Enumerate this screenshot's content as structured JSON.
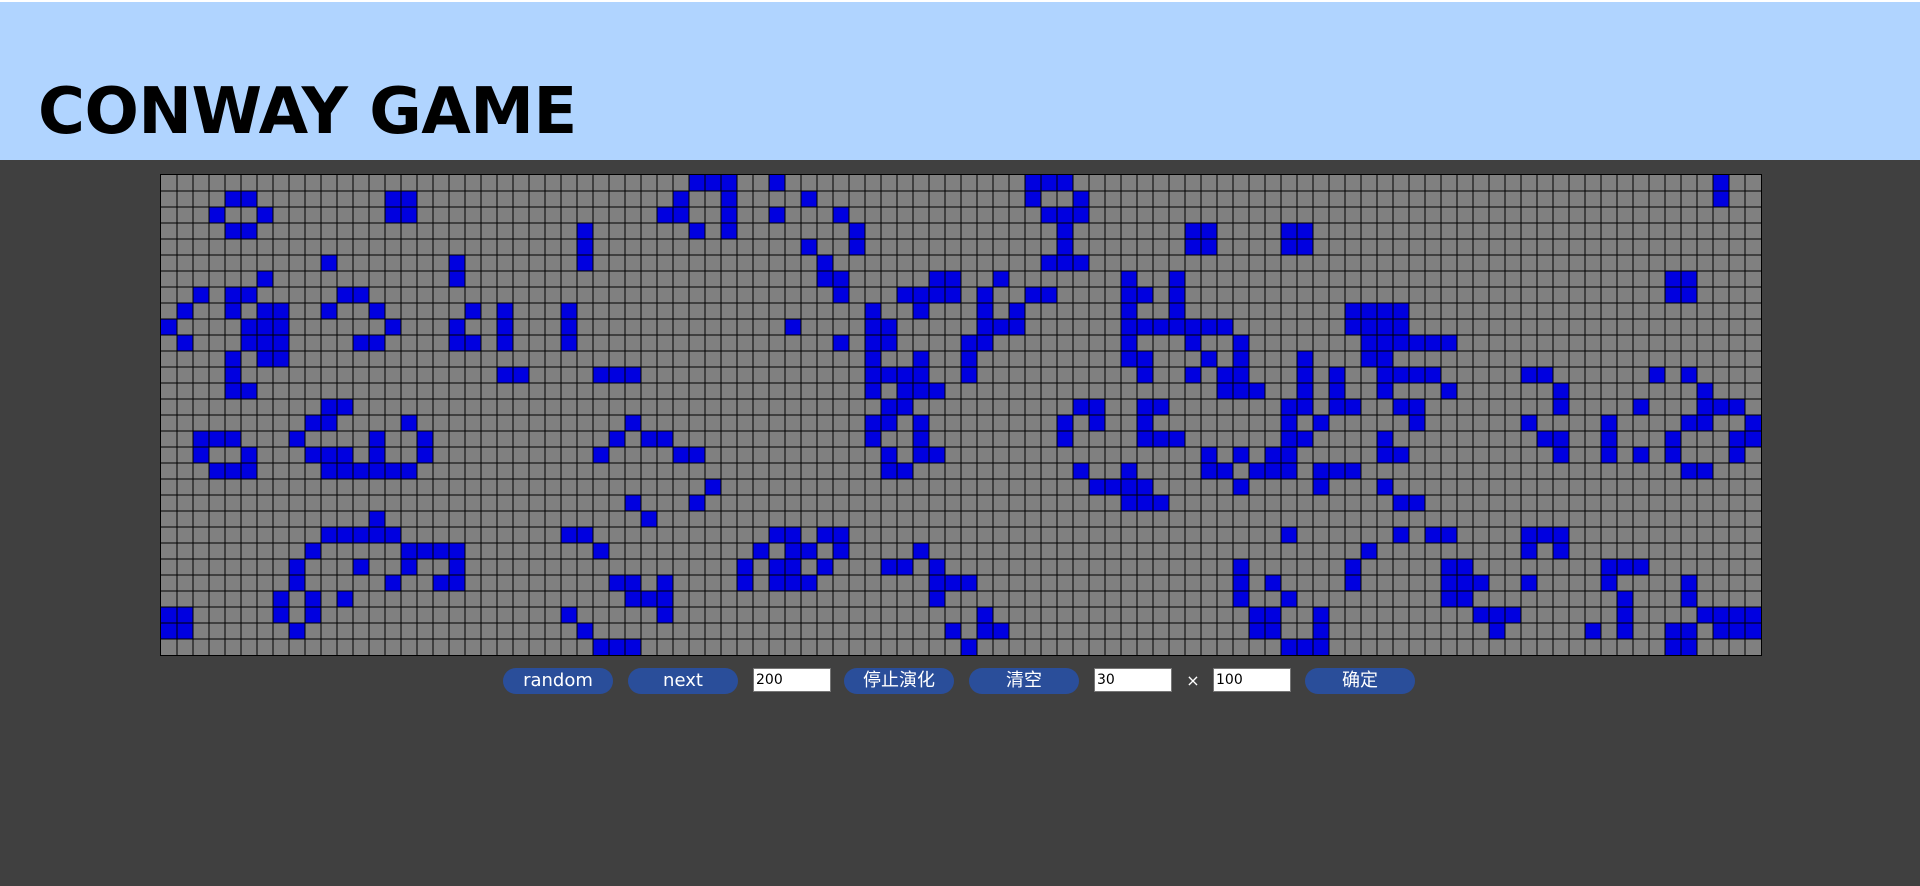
{
  "header": {
    "title": "CONWAY GAME",
    "background_color": "#b0d4ff"
  },
  "board": {
    "rows": 30,
    "cols": 100,
    "cell_color": "#808080",
    "live_color": "#0000e0",
    "grid_color": "#000000",
    "live_cells": [
      [
        0,
        33
      ],
      [
        0,
        34
      ],
      [
        0,
        35
      ],
      [
        0,
        38
      ],
      [
        0,
        54
      ],
      [
        0,
        55
      ],
      [
        0,
        56
      ],
      [
        0,
        97
      ],
      [
        1,
        4
      ],
      [
        1,
        5
      ],
      [
        1,
        14
      ],
      [
        1,
        15
      ],
      [
        1,
        32
      ],
      [
        1,
        35
      ],
      [
        1,
        40
      ],
      [
        1,
        54
      ],
      [
        1,
        57
      ],
      [
        1,
        97
      ],
      [
        2,
        3
      ],
      [
        2,
        6
      ],
      [
        2,
        14
      ],
      [
        2,
        15
      ],
      [
        2,
        31
      ],
      [
        2,
        32
      ],
      [
        2,
        35
      ],
      [
        2,
        38
      ],
      [
        2,
        42
      ],
      [
        2,
        55
      ],
      [
        2,
        56
      ],
      [
        2,
        57
      ],
      [
        3,
        4
      ],
      [
        3,
        5
      ],
      [
        3,
        26
      ],
      [
        3,
        33
      ],
      [
        3,
        35
      ],
      [
        3,
        43
      ],
      [
        3,
        56
      ],
      [
        3,
        64
      ],
      [
        3,
        65
      ],
      [
        3,
        70
      ],
      [
        3,
        71
      ],
      [
        4,
        26
      ],
      [
        4,
        40
      ],
      [
        4,
        43
      ],
      [
        4,
        56
      ],
      [
        4,
        64
      ],
      [
        4,
        65
      ],
      [
        4,
        70
      ],
      [
        4,
        71
      ],
      [
        5,
        10
      ],
      [
        5,
        18
      ],
      [
        5,
        26
      ],
      [
        5,
        41
      ],
      [
        5,
        55
      ],
      [
        5,
        56
      ],
      [
        5,
        57
      ],
      [
        6,
        6
      ],
      [
        6,
        18
      ],
      [
        6,
        41
      ],
      [
        6,
        42
      ],
      [
        6,
        48
      ],
      [
        6,
        49
      ],
      [
        6,
        52
      ],
      [
        6,
        60
      ],
      [
        6,
        63
      ],
      [
        6,
        94
      ],
      [
        6,
        95
      ],
      [
        7,
        2
      ],
      [
        7,
        4
      ],
      [
        7,
        5
      ],
      [
        7,
        11
      ],
      [
        7,
        12
      ],
      [
        7,
        42
      ],
      [
        7,
        46
      ],
      [
        7,
        47
      ],
      [
        7,
        48
      ],
      [
        7,
        49
      ],
      [
        7,
        51
      ],
      [
        7,
        54
      ],
      [
        7,
        55
      ],
      [
        7,
        60
      ],
      [
        7,
        61
      ],
      [
        7,
        63
      ],
      [
        7,
        94
      ],
      [
        7,
        95
      ],
      [
        8,
        1
      ],
      [
        8,
        4
      ],
      [
        8,
        6
      ],
      [
        8,
        7
      ],
      [
        8,
        10
      ],
      [
        8,
        13
      ],
      [
        8,
        19
      ],
      [
        8,
        21
      ],
      [
        8,
        25
      ],
      [
        8,
        44
      ],
      [
        8,
        47
      ],
      [
        8,
        51
      ],
      [
        8,
        53
      ],
      [
        8,
        60
      ],
      [
        8,
        63
      ],
      [
        8,
        74
      ],
      [
        8,
        75
      ],
      [
        8,
        76
      ],
      [
        8,
        77
      ],
      [
        9,
        0
      ],
      [
        9,
        5
      ],
      [
        9,
        6
      ],
      [
        9,
        7
      ],
      [
        9,
        14
      ],
      [
        9,
        18
      ],
      [
        9,
        21
      ],
      [
        9,
        25
      ],
      [
        9,
        39
      ],
      [
        9,
        44
      ],
      [
        9,
        45
      ],
      [
        9,
        51
      ],
      [
        9,
        52
      ],
      [
        9,
        53
      ],
      [
        9,
        60
      ],
      [
        9,
        61
      ],
      [
        9,
        62
      ],
      [
        9,
        63
      ],
      [
        9,
        64
      ],
      [
        9,
        65
      ],
      [
        9,
        66
      ],
      [
        9,
        74
      ],
      [
        9,
        75
      ],
      [
        9,
        76
      ],
      [
        9,
        77
      ],
      [
        10,
        1
      ],
      [
        10,
        5
      ],
      [
        10,
        6
      ],
      [
        10,
        7
      ],
      [
        10,
        12
      ],
      [
        10,
        13
      ],
      [
        10,
        18
      ],
      [
        10,
        19
      ],
      [
        10,
        21
      ],
      [
        10,
        25
      ],
      [
        10,
        42
      ],
      [
        10,
        44
      ],
      [
        10,
        45
      ],
      [
        10,
        50
      ],
      [
        10,
        51
      ],
      [
        10,
        60
      ],
      [
        10,
        64
      ],
      [
        10,
        67
      ],
      [
        10,
        75
      ],
      [
        10,
        76
      ],
      [
        10,
        77
      ],
      [
        10,
        78
      ],
      [
        10,
        79
      ],
      [
        10,
        80
      ],
      [
        11,
        4
      ],
      [
        11,
        6
      ],
      [
        11,
        7
      ],
      [
        11,
        44
      ],
      [
        11,
        47
      ],
      [
        11,
        50
      ],
      [
        11,
        60
      ],
      [
        11,
        61
      ],
      [
        11,
        65
      ],
      [
        11,
        67
      ],
      [
        11,
        71
      ],
      [
        11,
        75
      ],
      [
        11,
        76
      ],
      [
        12,
        4
      ],
      [
        12,
        21
      ],
      [
        12,
        22
      ],
      [
        12,
        27
      ],
      [
        12,
        28
      ],
      [
        12,
        29
      ],
      [
        12,
        44
      ],
      [
        12,
        45
      ],
      [
        12,
        46
      ],
      [
        12,
        47
      ],
      [
        12,
        50
      ],
      [
        12,
        61
      ],
      [
        12,
        64
      ],
      [
        12,
        66
      ],
      [
        12,
        67
      ],
      [
        12,
        71
      ],
      [
        12,
        73
      ],
      [
        12,
        76
      ],
      [
        12,
        77
      ],
      [
        12,
        78
      ],
      [
        12,
        79
      ],
      [
        12,
        85
      ],
      [
        12,
        86
      ],
      [
        12,
        93
      ],
      [
        12,
        95
      ],
      [
        13,
        4
      ],
      [
        13,
        5
      ],
      [
        13,
        44
      ],
      [
        13,
        46
      ],
      [
        13,
        47
      ],
      [
        13,
        48
      ],
      [
        13,
        66
      ],
      [
        13,
        67
      ],
      [
        13,
        68
      ],
      [
        13,
        71
      ],
      [
        13,
        73
      ],
      [
        13,
        76
      ],
      [
        13,
        80
      ],
      [
        13,
        87
      ],
      [
        13,
        96
      ],
      [
        14,
        10
      ],
      [
        14,
        11
      ],
      [
        14,
        45
      ],
      [
        14,
        46
      ],
      [
        14,
        57
      ],
      [
        14,
        58
      ],
      [
        14,
        61
      ],
      [
        14,
        62
      ],
      [
        14,
        70
      ],
      [
        14,
        71
      ],
      [
        14,
        73
      ],
      [
        14,
        74
      ],
      [
        14,
        77
      ],
      [
        14,
        78
      ],
      [
        14,
        87
      ],
      [
        14,
        92
      ],
      [
        14,
        96
      ],
      [
        14,
        97
      ],
      [
        14,
        98
      ],
      [
        15,
        9
      ],
      [
        15,
        10
      ],
      [
        15,
        15
      ],
      [
        15,
        29
      ],
      [
        15,
        44
      ],
      [
        15,
        45
      ],
      [
        15,
        47
      ],
      [
        15,
        56
      ],
      [
        15,
        58
      ],
      [
        15,
        61
      ],
      [
        15,
        70
      ],
      [
        15,
        72
      ],
      [
        15,
        78
      ],
      [
        15,
        85
      ],
      [
        15,
        90
      ],
      [
        15,
        95
      ],
      [
        15,
        96
      ],
      [
        15,
        99
      ],
      [
        16,
        2
      ],
      [
        16,
        3
      ],
      [
        16,
        4
      ],
      [
        16,
        8
      ],
      [
        16,
        13
      ],
      [
        16,
        16
      ],
      [
        16,
        28
      ],
      [
        16,
        30
      ],
      [
        16,
        31
      ],
      [
        16,
        44
      ],
      [
        16,
        47
      ],
      [
        16,
        56
      ],
      [
        16,
        61
      ],
      [
        16,
        62
      ],
      [
        16,
        63
      ],
      [
        16,
        70
      ],
      [
        16,
        71
      ],
      [
        16,
        76
      ],
      [
        16,
        86
      ],
      [
        16,
        87
      ],
      [
        16,
        90
      ],
      [
        16,
        94
      ],
      [
        16,
        98
      ],
      [
        16,
        99
      ],
      [
        17,
        2
      ],
      [
        17,
        5
      ],
      [
        17,
        9
      ],
      [
        17,
        10
      ],
      [
        17,
        11
      ],
      [
        17,
        13
      ],
      [
        17,
        16
      ],
      [
        17,
        27
      ],
      [
        17,
        32
      ],
      [
        17,
        33
      ],
      [
        17,
        45
      ],
      [
        17,
        47
      ],
      [
        17,
        48
      ],
      [
        17,
        65
      ],
      [
        17,
        67
      ],
      [
        17,
        69
      ],
      [
        17,
        70
      ],
      [
        17,
        76
      ],
      [
        17,
        77
      ],
      [
        17,
        87
      ],
      [
        17,
        90
      ],
      [
        17,
        92
      ],
      [
        17,
        94
      ],
      [
        17,
        98
      ],
      [
        18,
        3
      ],
      [
        18,
        4
      ],
      [
        18,
        5
      ],
      [
        18,
        10
      ],
      [
        18,
        11
      ],
      [
        18,
        12
      ],
      [
        18,
        13
      ],
      [
        18,
        14
      ],
      [
        18,
        15
      ],
      [
        18,
        45
      ],
      [
        18,
        46
      ],
      [
        18,
        57
      ],
      [
        18,
        60
      ],
      [
        18,
        65
      ],
      [
        18,
        66
      ],
      [
        18,
        68
      ],
      [
        18,
        69
      ],
      [
        18,
        70
      ],
      [
        18,
        72
      ],
      [
        18,
        73
      ],
      [
        18,
        74
      ],
      [
        18,
        95
      ],
      [
        18,
        96
      ],
      [
        19,
        34
      ],
      [
        19,
        58
      ],
      [
        19,
        59
      ],
      [
        19,
        60
      ],
      [
        19,
        61
      ],
      [
        19,
        67
      ],
      [
        19,
        72
      ],
      [
        19,
        76
      ],
      [
        20,
        29
      ],
      [
        20,
        33
      ],
      [
        20,
        60
      ],
      [
        20,
        61
      ],
      [
        20,
        62
      ],
      [
        20,
        77
      ],
      [
        20,
        78
      ],
      [
        21,
        13
      ],
      [
        21,
        30
      ],
      [
        22,
        10
      ],
      [
        22,
        11
      ],
      [
        22,
        12
      ],
      [
        22,
        13
      ],
      [
        22,
        14
      ],
      [
        22,
        25
      ],
      [
        22,
        26
      ],
      [
        22,
        38
      ],
      [
        22,
        39
      ],
      [
        22,
        41
      ],
      [
        22,
        42
      ],
      [
        22,
        70
      ],
      [
        22,
        77
      ],
      [
        22,
        79
      ],
      [
        22,
        80
      ],
      [
        22,
        85
      ],
      [
        22,
        86
      ],
      [
        22,
        87
      ],
      [
        23,
        9
      ],
      [
        23,
        15
      ],
      [
        23,
        16
      ],
      [
        23,
        17
      ],
      [
        23,
        18
      ],
      [
        23,
        27
      ],
      [
        23,
        37
      ],
      [
        23,
        39
      ],
      [
        23,
        40
      ],
      [
        23,
        42
      ],
      [
        23,
        47
      ],
      [
        23,
        75
      ],
      [
        23,
        85
      ],
      [
        23,
        87
      ],
      [
        24,
        8
      ],
      [
        24,
        12
      ],
      [
        24,
        15
      ],
      [
        24,
        18
      ],
      [
        24,
        36
      ],
      [
        24,
        38
      ],
      [
        24,
        39
      ],
      [
        24,
        41
      ],
      [
        24,
        45
      ],
      [
        24,
        46
      ],
      [
        24,
        48
      ],
      [
        24,
        67
      ],
      [
        24,
        74
      ],
      [
        24,
        80
      ],
      [
        24,
        81
      ],
      [
        24,
        90
      ],
      [
        24,
        91
      ],
      [
        24,
        92
      ],
      [
        25,
        8
      ],
      [
        25,
        14
      ],
      [
        25,
        17
      ],
      [
        25,
        18
      ],
      [
        25,
        28
      ],
      [
        25,
        29
      ],
      [
        25,
        31
      ],
      [
        25,
        36
      ],
      [
        25,
        38
      ],
      [
        25,
        39
      ],
      [
        25,
        40
      ],
      [
        25,
        48
      ],
      [
        25,
        49
      ],
      [
        25,
        50
      ],
      [
        25,
        67
      ],
      [
        25,
        69
      ],
      [
        25,
        74
      ],
      [
        25,
        80
      ],
      [
        25,
        81
      ],
      [
        25,
        82
      ],
      [
        25,
        85
      ],
      [
        25,
        90
      ],
      [
        25,
        95
      ],
      [
        26,
        7
      ],
      [
        26,
        9
      ],
      [
        26,
        11
      ],
      [
        26,
        29
      ],
      [
        26,
        30
      ],
      [
        26,
        31
      ],
      [
        26,
        48
      ],
      [
        26,
        67
      ],
      [
        26,
        70
      ],
      [
        26,
        80
      ],
      [
        26,
        81
      ],
      [
        26,
        91
      ],
      [
        26,
        95
      ],
      [
        27,
        0
      ],
      [
        27,
        1
      ],
      [
        27,
        7
      ],
      [
        27,
        9
      ],
      [
        27,
        25
      ],
      [
        27,
        31
      ],
      [
        27,
        51
      ],
      [
        27,
        68
      ],
      [
        27,
        69
      ],
      [
        27,
        72
      ],
      [
        27,
        82
      ],
      [
        27,
        83
      ],
      [
        27,
        84
      ],
      [
        27,
        91
      ],
      [
        27,
        96
      ],
      [
        27,
        97
      ],
      [
        27,
        98
      ],
      [
        27,
        99
      ],
      [
        28,
        0
      ],
      [
        28,
        1
      ],
      [
        28,
        8
      ],
      [
        28,
        26
      ],
      [
        28,
        49
      ],
      [
        28,
        51
      ],
      [
        28,
        52
      ],
      [
        28,
        68
      ],
      [
        28,
        69
      ],
      [
        28,
        72
      ],
      [
        28,
        83
      ],
      [
        28,
        89
      ],
      [
        28,
        91
      ],
      [
        28,
        94
      ],
      [
        28,
        95
      ],
      [
        28,
        97
      ],
      [
        28,
        98
      ],
      [
        28,
        99
      ],
      [
        29,
        27
      ],
      [
        29,
        28
      ],
      [
        29,
        29
      ],
      [
        29,
        50
      ],
      [
        29,
        70
      ],
      [
        29,
        71
      ],
      [
        29,
        72
      ],
      [
        29,
        94
      ],
      [
        29,
        95
      ]
    ]
  },
  "controls": {
    "button_color": "#2a4e9a",
    "random_label": "random",
    "next_label": "next",
    "interval_value": "200",
    "stop_label": "停止演化",
    "clear_label": "清空",
    "rows_value": "30",
    "times_label": "×",
    "cols_value": "100",
    "confirm_label": "确定"
  }
}
